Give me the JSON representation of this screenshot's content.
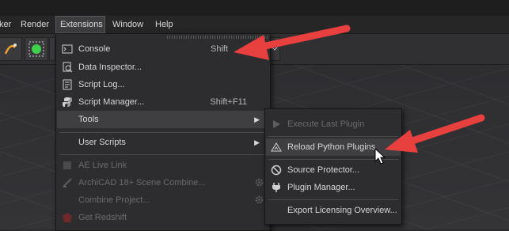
{
  "menubar": {
    "items": [
      {
        "label": "ker"
      },
      {
        "label": "Render"
      },
      {
        "label": "Extensions"
      },
      {
        "label": "Window"
      },
      {
        "label": "Help"
      }
    ]
  },
  "extensions_menu": {
    "items": [
      {
        "label": "Console",
        "shortcut": "Shift",
        "icon": "terminal-icon"
      },
      {
        "label": "Data Inspector...",
        "icon": "inspector-icon"
      },
      {
        "label": "Script Log...",
        "icon": "script-log-icon"
      },
      {
        "label": "Script Manager...",
        "shortcut": "Shift+F11",
        "icon": "python-icon"
      },
      {
        "label": "Tools",
        "submenu": true
      },
      {
        "label": "User Scripts",
        "submenu": true
      },
      {
        "label": "AE Live Link",
        "icon": "ae-link-icon",
        "disabled": true
      },
      {
        "label": "ArchiCAD 18+ Scene Combine...",
        "icon": "archicad-icon",
        "disabled": true
      },
      {
        "label": "Combine Project...",
        "disabled": true
      },
      {
        "label": "Get Redshift",
        "icon": "redshift-icon",
        "disabled": true
      }
    ]
  },
  "tools_submenu": {
    "items": [
      {
        "label": "Execute Last Plugin",
        "icon": "play-icon",
        "disabled": true
      },
      {
        "label": "Reload Python Plugins",
        "icon": "reload-triangle-icon"
      },
      {
        "label": "Source Protector...",
        "icon": "prohibited-icon"
      },
      {
        "label": "Plugin Manager...",
        "icon": "plug-icon"
      },
      {
        "label": "Export Licensing Overview..."
      }
    ]
  },
  "colors": {
    "annotation_arrow": "#e8403f",
    "menu_bg": "#2d2d30",
    "highlight": "#3f3f42"
  }
}
